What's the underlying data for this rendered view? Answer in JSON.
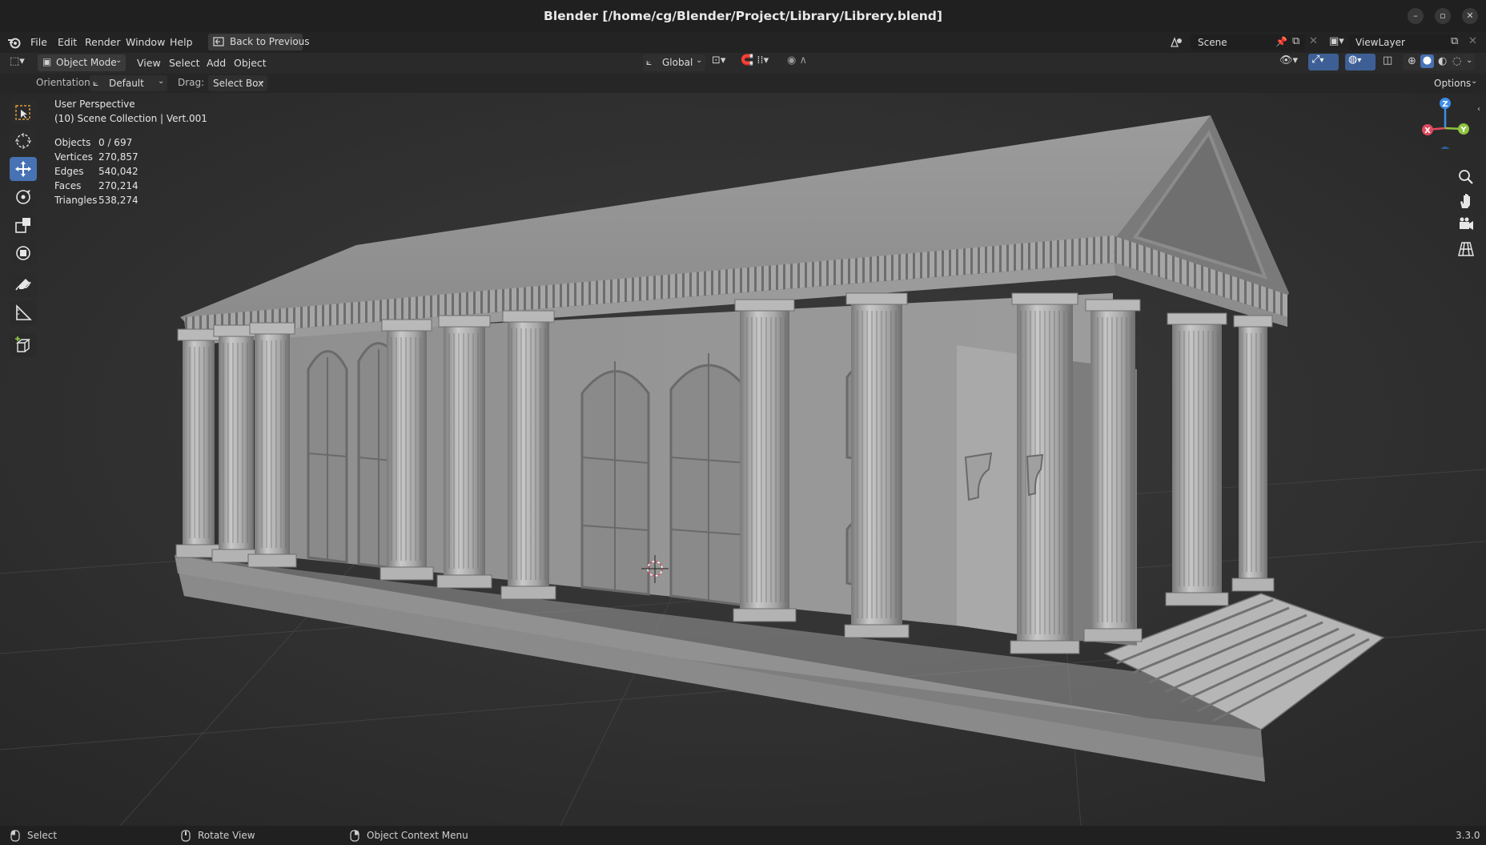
{
  "window": {
    "title": "Blender [/home/cg/Blender/Project/Library/Librery.blend]",
    "minimize_icon": "minimize-icon",
    "maximize_icon": "maximize-icon",
    "close_icon": "close-icon"
  },
  "menubar": {
    "items": [
      "File",
      "Edit",
      "Render",
      "Window",
      "Help"
    ],
    "back_label": "Back to Previous",
    "scene_label": "Scene",
    "viewlayer_label": "ViewLayer"
  },
  "header": {
    "mode": "Object Mode",
    "menus": [
      "View",
      "Select",
      "Add",
      "Object"
    ],
    "transform_orientation": "Global"
  },
  "toolsettings": {
    "orientation_label": "Orientation:",
    "orientation_value": "Default",
    "drag_label": "Drag:",
    "drag_value": "Select Box",
    "options_label": "Options"
  },
  "viewport": {
    "view_name": "User Perspective",
    "collection_info": "(10) Scene Collection | Vert.001",
    "stats": [
      {
        "label": "Objects",
        "value": "0 / 697"
      },
      {
        "label": "Vertices",
        "value": "270,857"
      },
      {
        "label": "Edges",
        "value": "540,042"
      },
      {
        "label": "Faces",
        "value": "270,214"
      },
      {
        "label": "Triangles",
        "value": "538,274"
      }
    ],
    "gizmo_axes": {
      "x": "X",
      "y": "Y",
      "z": "Z"
    },
    "axis_colors": {
      "x": "#e04a5f",
      "y": "#8dc43f",
      "z": "#3b8ee6"
    }
  },
  "toolbar": {
    "tools": [
      "select-box-icon",
      "cursor-icon",
      "move-icon",
      "rotate-icon",
      "scale-icon",
      "transform-icon",
      "annotate-icon",
      "measure-icon",
      "add-cube-icon"
    ],
    "active_tool": "move-icon",
    "accent_color": "#4772b3"
  },
  "statusbar": {
    "select": "Select",
    "rotate": "Rotate View",
    "context_menu": "Object Context Menu",
    "version": "3.3.0"
  }
}
